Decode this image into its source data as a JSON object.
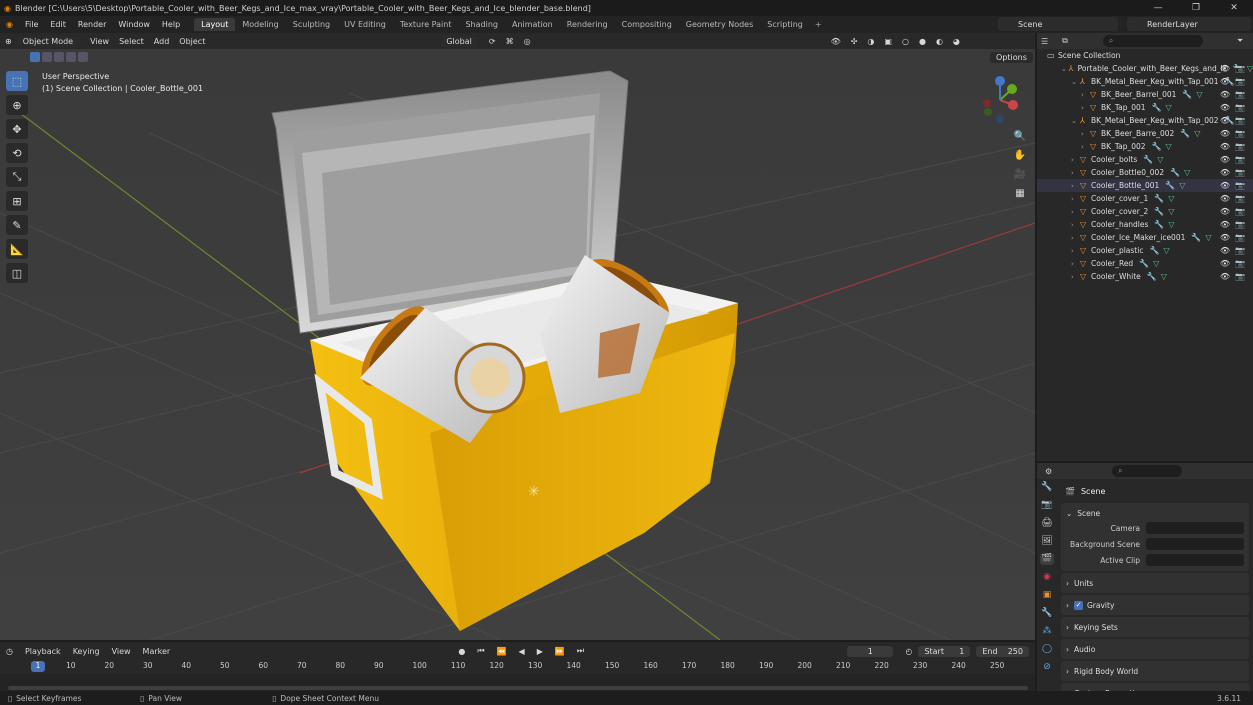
{
  "title": "Blender [C:\\Users\\5\\Desktop\\Portable_Cooler_with_Beer_Kegs_and_Ice_max_vray\\Portable_Cooler_with_Beer_Kegs_and_Ice_blender_base.blend]",
  "menu": [
    "File",
    "Edit",
    "Render",
    "Window",
    "Help"
  ],
  "workspaces": [
    "Layout",
    "Modeling",
    "Sculpting",
    "UV Editing",
    "Texture Paint",
    "Shading",
    "Animation",
    "Rendering",
    "Compositing",
    "Geometry Nodes",
    "Scripting"
  ],
  "active_workspace": "Layout",
  "scene_name": "Scene",
  "render_layer": "RenderLayer",
  "viewport": {
    "mode": "Object Mode",
    "menus": [
      "View",
      "Select",
      "Add",
      "Object"
    ],
    "transform": "Global",
    "options": "Options",
    "info_line1": "User Perspective",
    "info_line2": "(1) Scene Collection | Cooler_Bottle_001"
  },
  "outliner": {
    "root": "Scene Collection",
    "rows": [
      {
        "indent": 1,
        "label": "Portable_Cooler_with_Beer_Kegs_and_Ic",
        "icon": "empty"
      },
      {
        "indent": 2,
        "label": "BK_Metal_Beer_Keg_with_Tap_001",
        "icon": "empty"
      },
      {
        "indent": 3,
        "label": "BK_Beer_Barrel_001",
        "icon": "mesh"
      },
      {
        "indent": 3,
        "label": "BK_Tap_001",
        "icon": "mesh"
      },
      {
        "indent": 2,
        "label": "BK_Metal_Beer_Keg_with_Tap_002",
        "icon": "empty"
      },
      {
        "indent": 3,
        "label": "BK_Beer_Barre_002",
        "icon": "mesh"
      },
      {
        "indent": 3,
        "label": "BK_Tap_002",
        "icon": "mesh"
      },
      {
        "indent": 2,
        "label": "Cooler_bolts",
        "icon": "mesh"
      },
      {
        "indent": 2,
        "label": "Cooler_Bottle0_002",
        "icon": "mesh"
      },
      {
        "indent": 2,
        "label": "Cooler_Bottle_001",
        "icon": "mesh",
        "selected": true
      },
      {
        "indent": 2,
        "label": "Cooler_cover_1",
        "icon": "mesh"
      },
      {
        "indent": 2,
        "label": "Cooler_cover_2",
        "icon": "mesh"
      },
      {
        "indent": 2,
        "label": "Cooler_handles",
        "icon": "mesh"
      },
      {
        "indent": 2,
        "label": "Cooler_Ice_Maker_ice001",
        "icon": "mesh"
      },
      {
        "indent": 2,
        "label": "Cooler_plastic",
        "icon": "mesh"
      },
      {
        "indent": 2,
        "label": "Cooler_Red",
        "icon": "mesh"
      },
      {
        "indent": 2,
        "label": "Cooler_White",
        "icon": "mesh"
      }
    ]
  },
  "properties": {
    "title": "Scene",
    "scene_panel": "Scene",
    "fields": [
      {
        "label": "Camera"
      },
      {
        "label": "Background Scene"
      },
      {
        "label": "Active Clip"
      }
    ],
    "panels": [
      "Units",
      "Gravity",
      "Keying Sets",
      "Audio",
      "Rigid Body World",
      "Custom Properties"
    ],
    "gravity_checked": true
  },
  "timeline": {
    "menus": [
      "Playback",
      "Keying",
      "View",
      "Marker"
    ],
    "current_frame": "1",
    "start_label": "Start",
    "start": "1",
    "end_label": "End",
    "end": "250",
    "ruler": [
      "10",
      "20",
      "30",
      "40",
      "50",
      "60",
      "70",
      "80",
      "90",
      "100",
      "110",
      "120",
      "130",
      "140",
      "150",
      "160",
      "170",
      "180",
      "190",
      "200",
      "210",
      "220",
      "230",
      "240",
      "250"
    ]
  },
  "status": {
    "left": "Select Keyframes",
    "mid": "Pan View",
    "right": "Dope Sheet Context Menu",
    "version": "3.6.11"
  }
}
